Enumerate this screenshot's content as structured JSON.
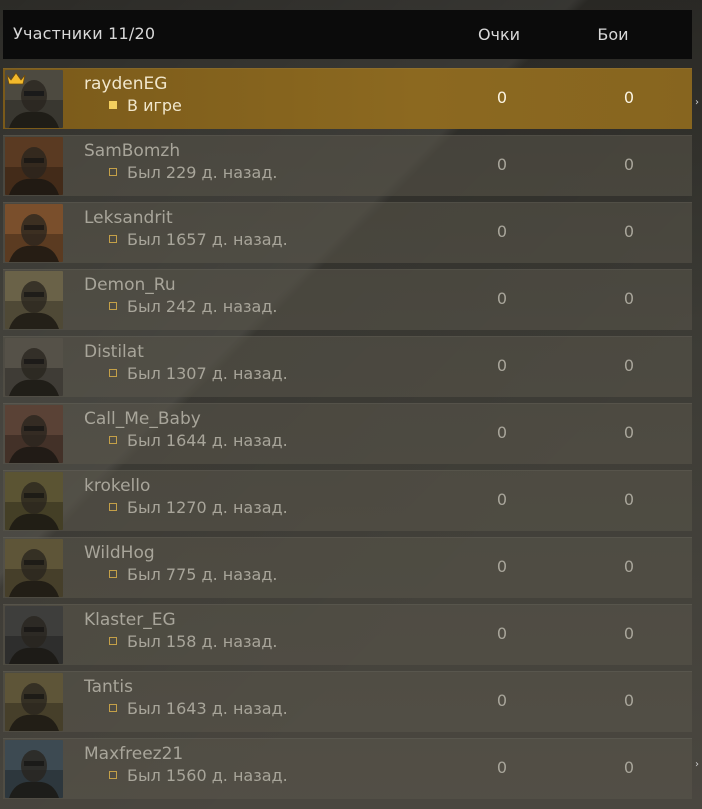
{
  "header": {
    "title": "Участники 11/20",
    "col_points": "Очки",
    "col_battles": "Бои"
  },
  "members": [
    {
      "name": "raydenEG",
      "status": "В игре",
      "points": "0",
      "battles": "0",
      "active": true,
      "leader": true,
      "avatar_color": "#4d4a40"
    },
    {
      "name": "SamBomzh",
      "status": "Был 229 д. назад.",
      "points": "0",
      "battles": "0",
      "active": false,
      "leader": false,
      "avatar_color": "#5a3a22"
    },
    {
      "name": "Leksandrit",
      "status": "Был 1657 д. назад.",
      "points": "0",
      "battles": "0",
      "active": false,
      "leader": false,
      "avatar_color": "#7a4f2c"
    },
    {
      "name": "Demon_Ru",
      "status": "Был 242 д. назад.",
      "points": "0",
      "battles": "0",
      "active": false,
      "leader": false,
      "avatar_color": "#6a6248"
    },
    {
      "name": "Distilat",
      "status": "Был 1307 д. назад.",
      "points": "0",
      "battles": "0",
      "active": false,
      "leader": false,
      "avatar_color": "#555148"
    },
    {
      "name": "Call_Me_Baby",
      "status": "Был 1644 д. назад.",
      "points": "0",
      "battles": "0",
      "active": false,
      "leader": false,
      "avatar_color": "#5a4236"
    },
    {
      "name": "krokello",
      "status": "Был 1270 д. назад.",
      "points": "0",
      "battles": "0",
      "active": false,
      "leader": false,
      "avatar_color": "#5b5433"
    },
    {
      "name": "WildHog",
      "status": "Был 775 д. назад.",
      "points": "0",
      "battles": "0",
      "active": false,
      "leader": false,
      "avatar_color": "#5e5538"
    },
    {
      "name": "Klaster_EG",
      "status": "Был 158 д. назад.",
      "points": "0",
      "battles": "0",
      "active": false,
      "leader": false,
      "avatar_color": "#3e3e3c"
    },
    {
      "name": "Tantis",
      "status": "Был 1643 д. назад.",
      "points": "0",
      "battles": "0",
      "active": false,
      "leader": false,
      "avatar_color": "#5e5538"
    },
    {
      "name": "Maxfreez21",
      "status": "Был 1560 д. назад.",
      "points": "0",
      "battles": "0",
      "active": false,
      "leader": false,
      "avatar_color": "#3d4a52"
    }
  ],
  "colors": {
    "active_row": "#8c6920",
    "header_bg": "#0b0b0b",
    "status_dot_online": "#f4cf5e",
    "status_dot_offline": "#c4a048"
  },
  "icons": {
    "leader": "crown-icon",
    "online": "online-status-icon",
    "offline": "offline-status-icon"
  }
}
